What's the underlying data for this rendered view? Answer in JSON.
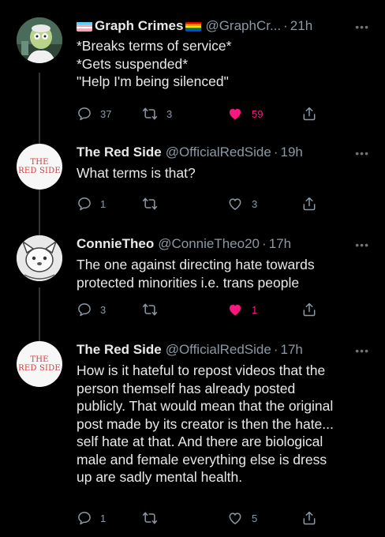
{
  "tweets": [
    {
      "name": "Graph Crimes",
      "handle": "@GraphCr...",
      "time": "21h",
      "lines": [
        "*Breaks terms of service*",
        "*Gets suspended*",
        "\"Help I'm being silenced\""
      ],
      "replies": "37",
      "retweets": "3",
      "likes": "59",
      "liked": true
    },
    {
      "name": "The Red Side",
      "handle": "@OfficialRedSide",
      "time": "19h",
      "avatar_text": [
        "THE",
        "RED SIDE"
      ],
      "lines": [
        "What terms is that?"
      ],
      "replies": "1",
      "retweets": "",
      "likes": "3",
      "liked": false
    },
    {
      "name": "ConnieTheo",
      "handle": "@ConnieTheo20",
      "time": "17h",
      "lines": [
        "The one against directing hate towards",
        "protected minorities i.e. trans people"
      ],
      "replies": "3",
      "retweets": "",
      "likes": "1",
      "liked": true
    },
    {
      "name": "The Red Side",
      "handle": "@OfficialRedSide",
      "time": "17h",
      "avatar_text": [
        "THE",
        "RED SIDE"
      ],
      "lines": [
        "How is it hateful to repost videos that the",
        "person themself has already posted",
        "publicly. That would mean that the original",
        "post made by its creator is then the hate...",
        "self hate at that. And there are biological",
        "male and female everything else is dress",
        "up are sadly mental health."
      ],
      "replies": "1",
      "retweets": "",
      "likes": "5",
      "liked": false
    }
  ],
  "separator": "·",
  "more_glyph": "•••",
  "colors": {
    "like_active": "#f91880",
    "muted": "#8b98a5",
    "text": "#e7e9ea"
  }
}
